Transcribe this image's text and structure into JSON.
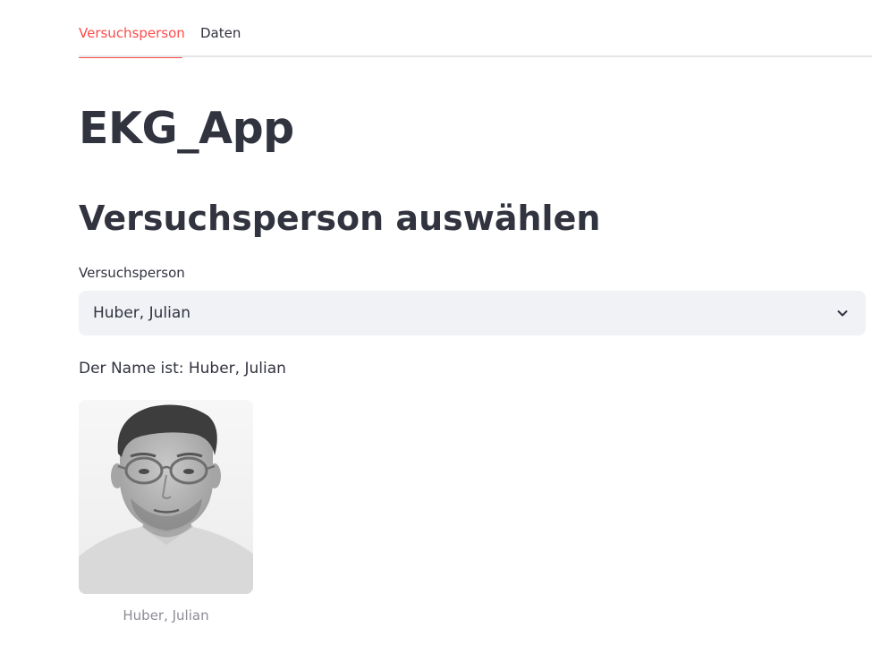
{
  "tabs": [
    {
      "label": "Versuchsperson",
      "active": true
    },
    {
      "label": "Daten",
      "active": false
    }
  ],
  "title": "EKG_App",
  "subheader": "Versuchsperson auswählen",
  "select": {
    "label": "Versuchsperson",
    "value": "Huber, Julian",
    "icon": "chevron-down-icon"
  },
  "name_line": "Der Name ist: Huber, Julian",
  "image": {
    "caption": "Huber, Julian"
  },
  "colors": {
    "accent": "#ff4b4b",
    "text": "#31333f",
    "select_bg": "#f0f2f6",
    "caption": "#8c8e95"
  }
}
